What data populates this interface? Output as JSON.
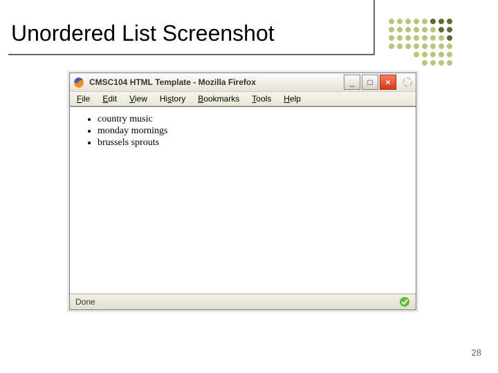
{
  "slide": {
    "title": "Unordered List Screenshot",
    "page_number": "28"
  },
  "browser": {
    "window_title": "CMSC104 HTML Template - Mozilla Firefox",
    "menus": {
      "file": "File",
      "edit": "Edit",
      "view": "View",
      "history": "History",
      "bookmarks": "Bookmarks",
      "tools": "Tools",
      "help": "Help"
    },
    "content": {
      "list_items": [
        "country music",
        "monday mornings",
        "brussels sprouts"
      ]
    },
    "status": "Done"
  },
  "window_buttons": {
    "minimize": "_",
    "maximize": "□",
    "close": "×"
  }
}
